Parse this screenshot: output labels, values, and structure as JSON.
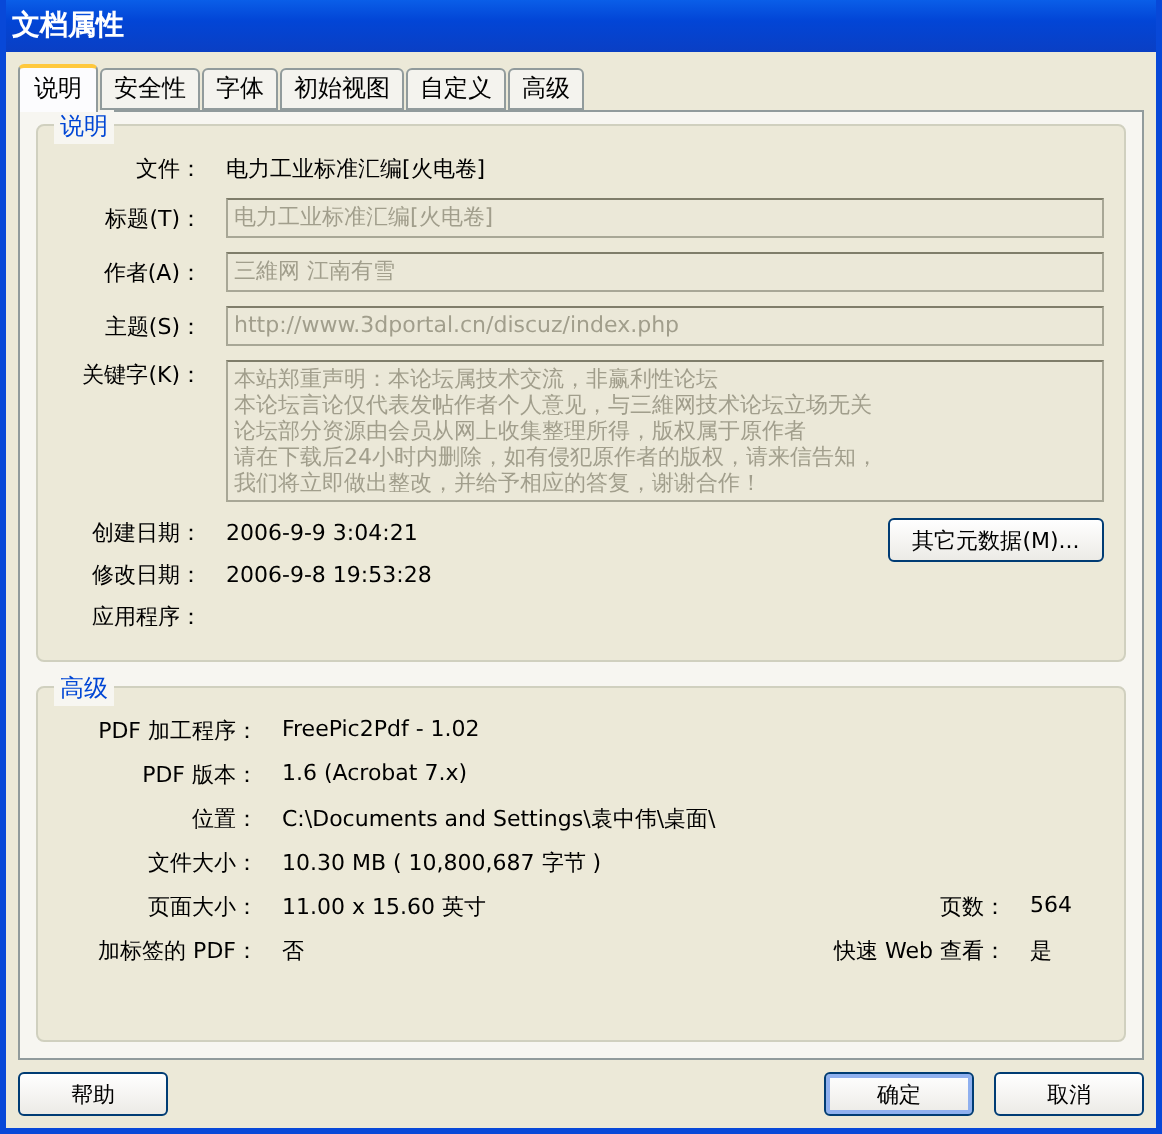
{
  "window": {
    "title": "文档属性"
  },
  "tabs": [
    {
      "label": "说明",
      "selected": true
    },
    {
      "label": "安全性",
      "selected": false
    },
    {
      "label": "字体",
      "selected": false
    },
    {
      "label": "初始视图",
      "selected": false
    },
    {
      "label": "自定义",
      "selected": false
    },
    {
      "label": "高级",
      "selected": false
    }
  ],
  "description": {
    "heading": "说明",
    "file": {
      "label": "文件：",
      "value": "电力工业标准汇编[火电卷]"
    },
    "fields": [
      {
        "label": "标题(T)：",
        "value": "电力工业标准汇编[火电卷]",
        "kind": "line",
        "disabled": true
      },
      {
        "label": "作者(A)：",
        "value": "三維网 江南有雪",
        "kind": "line",
        "disabled": true
      },
      {
        "label": "主题(S)：",
        "value": "http://www.3dportal.cn/discuz/index.php",
        "kind": "line",
        "disabled": true
      },
      {
        "label": "关键字(K)：",
        "lines": [
          "本站郑重声明：本论坛属技术交流，非赢利性论坛",
          "本论坛言论仅代表发帖作者个人意见，与三維网技术论坛立场无关",
          "论坛部分资源由会员从网上收集整理所得，版权属于原作者",
          "请在下载后24小时内删除，如有侵犯原作者的版权，请来信告知，",
          "我们将立即做出整改，并给予相应的答复，谢谢合作！"
        ],
        "kind": "multiline",
        "disabled": true
      }
    ],
    "dates": [
      {
        "label": "创建日期：",
        "value": "2006-9-9 3:04:21"
      },
      {
        "label": "修改日期：",
        "value": "2006-9-8 19:53:28"
      },
      {
        "label": "应用程序："
      }
    ],
    "more_button": "其它元数据(M)..."
  },
  "advanced": {
    "heading": "高级",
    "rows": [
      {
        "label": "PDF 加工程序：",
        "value": "FreePic2Pdf - 1.02"
      },
      {
        "label": "PDF 版本：",
        "value": "1.6 (Acrobat 7.x)"
      },
      {
        "label": "位置：",
        "value": "C:\\Documents and Settings\\袁中伟\\桌面\\"
      },
      {
        "label": "文件大小：",
        "value": "10.30 MB ( 10,800,687 字节 )"
      },
      {
        "label": "页面大小：",
        "value": "11.00 x 15.60 英寸",
        "extra": {
          "label": "页数：",
          "value": "564"
        }
      },
      {
        "label": "加标签的 PDF：",
        "value": "否",
        "extra": {
          "label": "快速 Web 查看：",
          "value": "是"
        }
      }
    ]
  },
  "buttons": [
    {
      "label": "帮助",
      "kind": "help",
      "default": false
    },
    {
      "label": "确定",
      "kind": "ok",
      "default": true
    },
    {
      "label": "取消",
      "kind": "cancel",
      "default": false
    }
  ]
}
